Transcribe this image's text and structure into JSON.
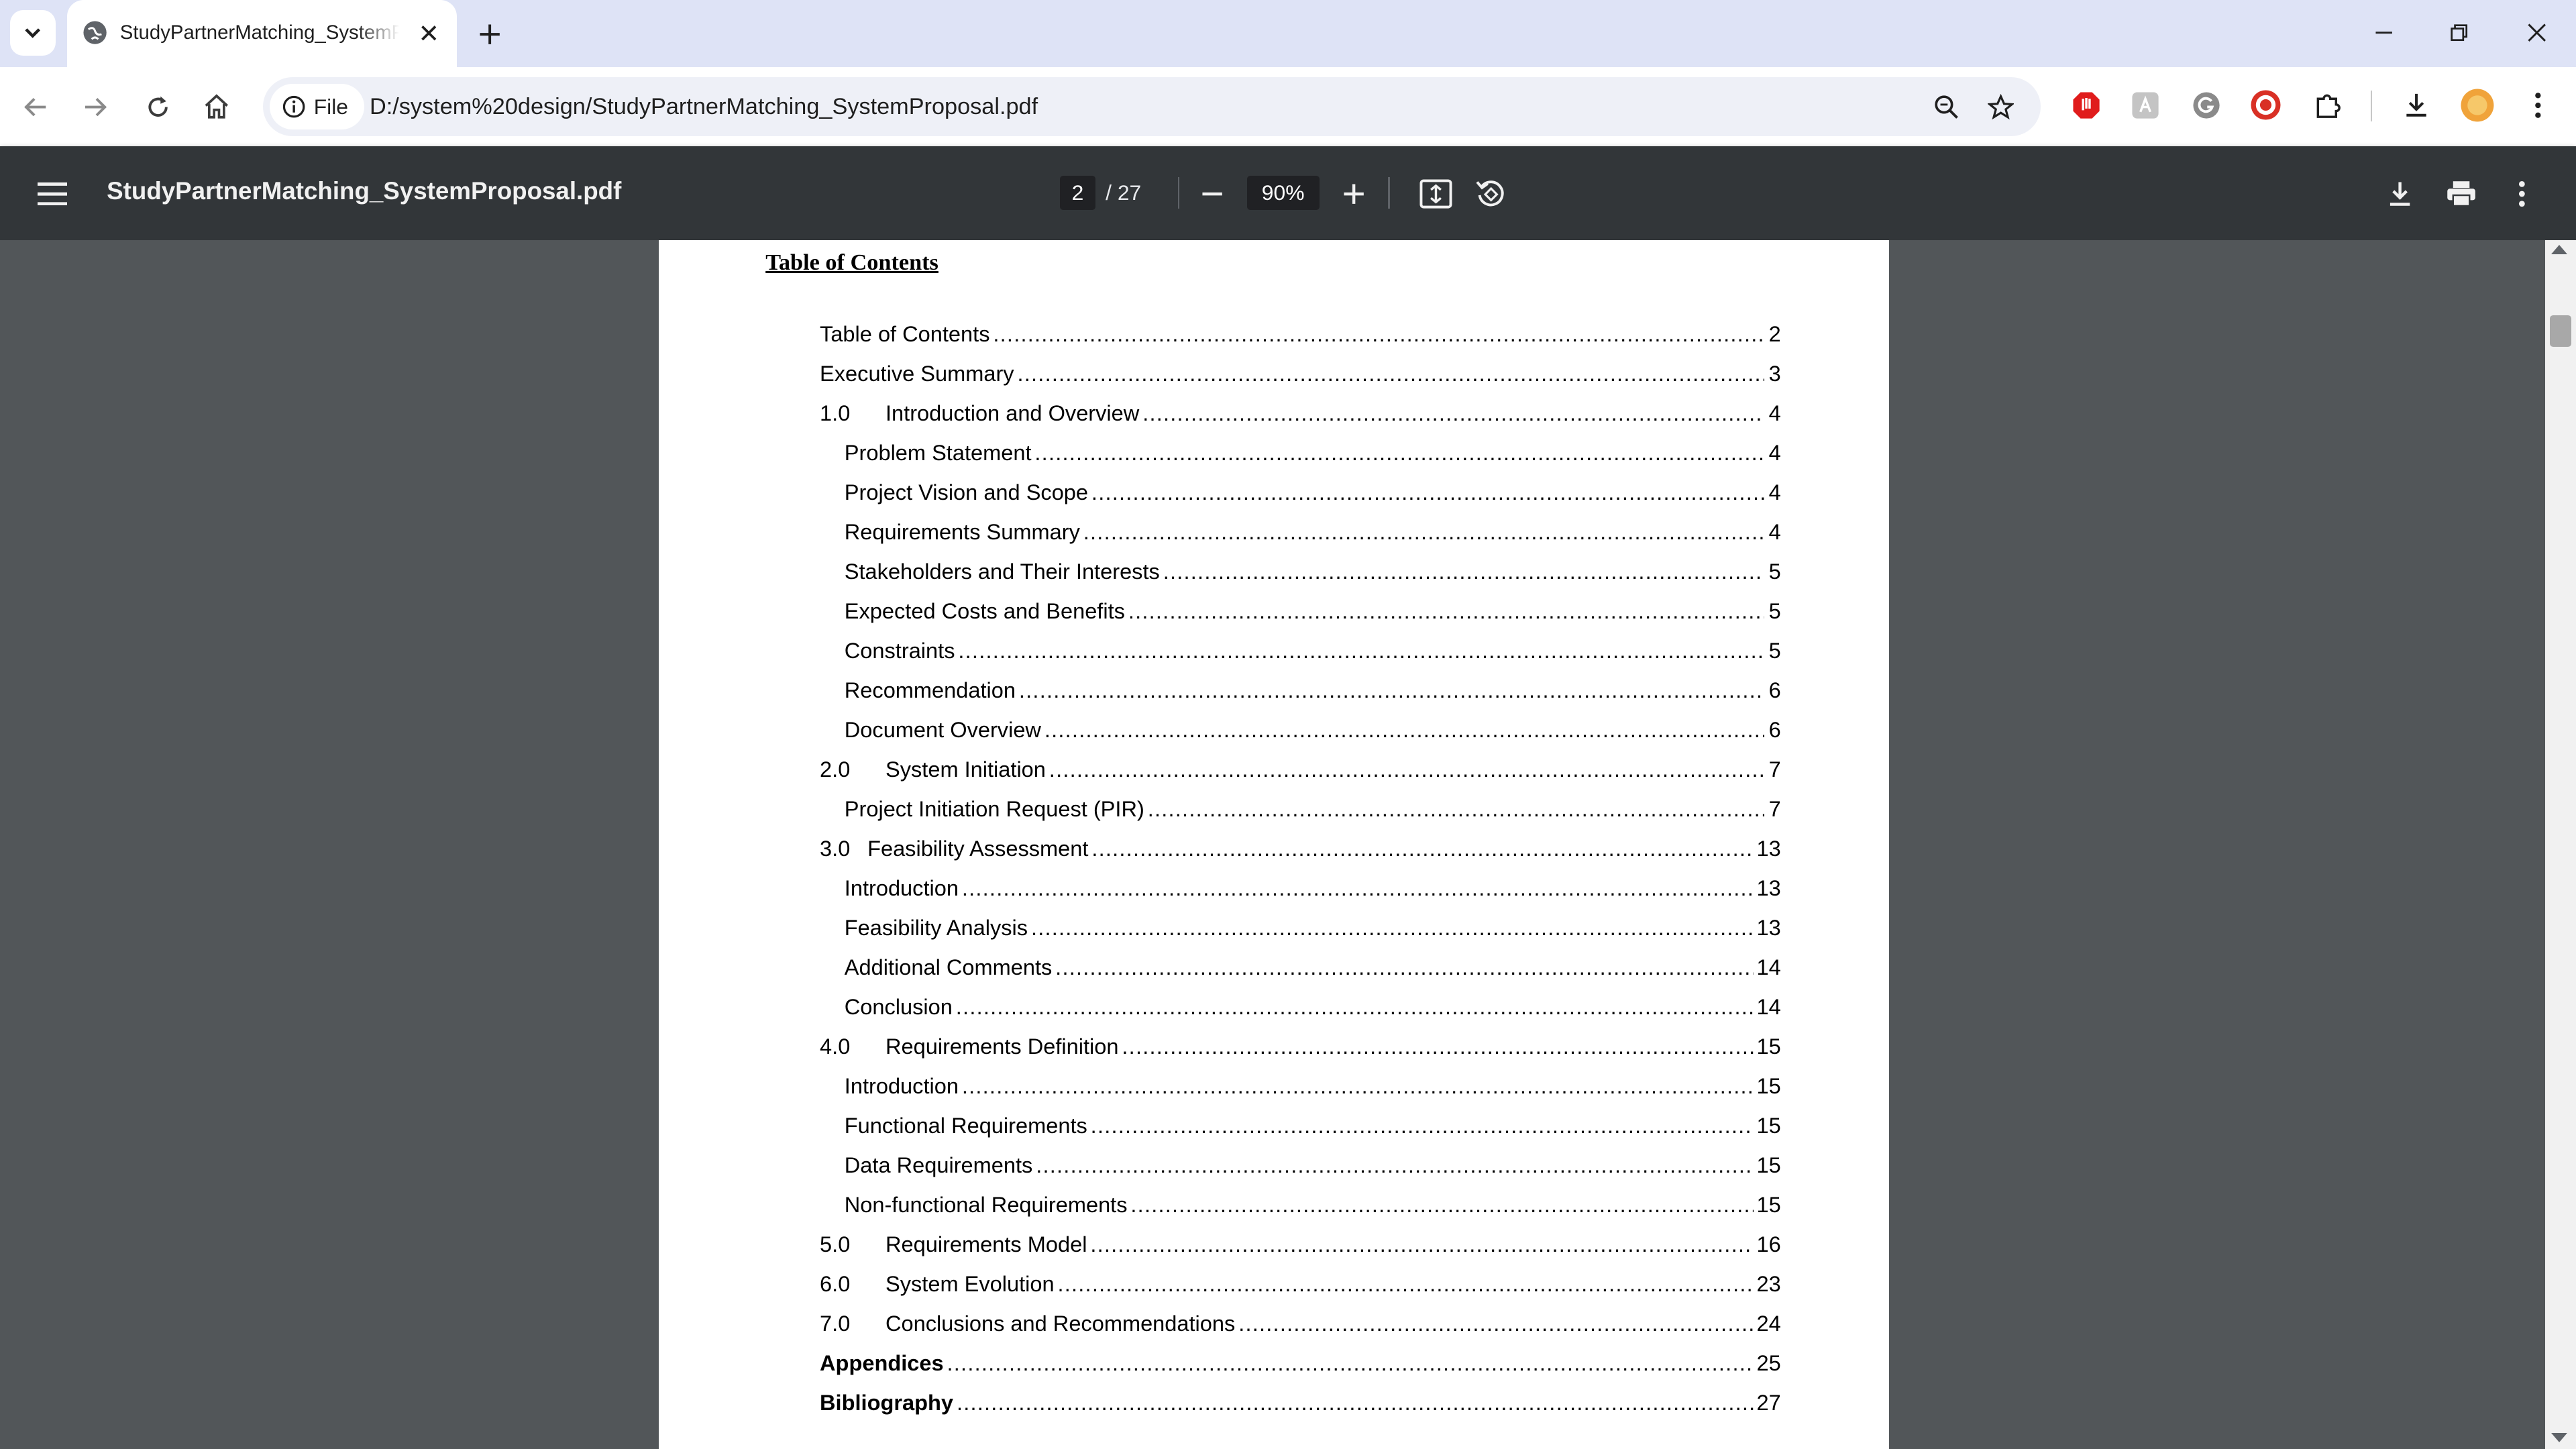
{
  "browser": {
    "tab_title": "StudyPartnerMatching_SystemProposal.pdf - StudyPartnerMatching_SystemProposal.pdf",
    "site_chip_label": "File",
    "url": "D:/system%20design/StudyPartnerMatching_SystemProposal.pdf",
    "accent_color": "#dee3f6"
  },
  "pdf_viewer": {
    "title": "StudyPartnerMatching_SystemProposal.pdf",
    "current_page": "2",
    "total_pages": "/  27",
    "zoom": "90%"
  },
  "document": {
    "heading": "Table of Contents",
    "toc": [
      {
        "num": "",
        "text": "Table of Contents",
        "page": "2",
        "indent": false,
        "bold": false
      },
      {
        "num": "",
        "text": "Executive Summary",
        "page": "3",
        "indent": false,
        "bold": false
      },
      {
        "num": "1.0",
        "text": "Introduction and Overview",
        "page": "4",
        "indent": false,
        "bold": false
      },
      {
        "num": "",
        "text": "Problem Statement",
        "page": "4",
        "indent": true,
        "bold": false
      },
      {
        "num": "",
        "text": "Project Vision and Scope",
        "page": "4",
        "indent": true,
        "bold": false
      },
      {
        "num": "",
        "text": "Requirements Summary",
        "page": "4",
        "indent": true,
        "bold": false
      },
      {
        "num": "",
        "text": "Stakeholders and Their Interests",
        "page": "5",
        "indent": true,
        "bold": false
      },
      {
        "num": "",
        "text": "Expected Costs and Benefits",
        "page": "5",
        "indent": true,
        "bold": false
      },
      {
        "num": "",
        "text": "Constraints",
        "page": "5",
        "indent": true,
        "bold": false
      },
      {
        "num": "",
        "text": "Recommendation",
        "page": "6",
        "indent": true,
        "bold": false
      },
      {
        "num": "",
        "text": "Document Overview",
        "page": "6",
        "indent": true,
        "bold": false
      },
      {
        "num": "2.0",
        "text": "System Initiation",
        "page": "7",
        "indent": false,
        "bold": false
      },
      {
        "num": "",
        "text": "Project Initiation Request (PIR)",
        "page": "7",
        "indent": true,
        "bold": false
      },
      {
        "num": "3.0",
        "text": "Feasibility Assessment",
        "page": "13",
        "indent": false,
        "bold": false,
        "short": true
      },
      {
        "num": "",
        "text": "Introduction",
        "page": "13",
        "indent": true,
        "bold": false
      },
      {
        "num": "",
        "text": "Feasibility Analysis",
        "page": "13",
        "indent": true,
        "bold": false
      },
      {
        "num": "",
        "text": "Additional Comments",
        "page": "14",
        "indent": true,
        "bold": false
      },
      {
        "num": "",
        "text": "Conclusion",
        "page": "14",
        "indent": true,
        "bold": false
      },
      {
        "num": "4.0",
        "text": "Requirements Definition",
        "page": "15",
        "indent": false,
        "bold": false
      },
      {
        "num": "",
        "text": "Introduction",
        "page": "15",
        "indent": true,
        "bold": false
      },
      {
        "num": "",
        "text": "Functional Requirements",
        "page": "15",
        "indent": true,
        "bold": false
      },
      {
        "num": "",
        "text": "Data Requirements",
        "page": "15",
        "indent": true,
        "bold": false
      },
      {
        "num": "",
        "text": "Non-functional Requirements",
        "page": "15",
        "indent": true,
        "bold": false
      },
      {
        "num": "5.0",
        "text": "Requirements Model",
        "page": "16",
        "indent": false,
        "bold": false
      },
      {
        "num": "6.0",
        "text": "System Evolution",
        "page": "23",
        "indent": false,
        "bold": false
      },
      {
        "num": "7.0",
        "text": "Conclusions and Recommendations",
        "page": "24",
        "indent": false,
        "bold": false
      },
      {
        "num": "",
        "text": "Appendices",
        "page": "25",
        "indent": false,
        "bold": true
      },
      {
        "num": "",
        "text": "Bibliography",
        "page": "27",
        "indent": false,
        "bold": true
      }
    ]
  }
}
